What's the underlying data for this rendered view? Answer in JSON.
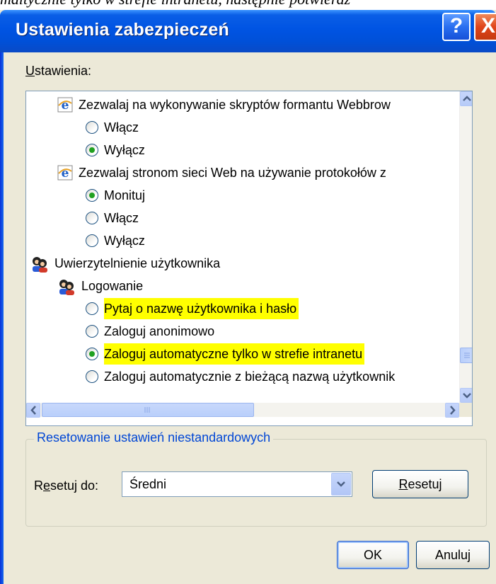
{
  "background_text": "maltycznie tylko w strefie intranetu, następnie potwierdź",
  "window": {
    "title": "Ustawienia zabezpieczeń",
    "help_label": "?",
    "close_label": "X"
  },
  "settings": {
    "label_first": "U",
    "label_rest": "stawienia:",
    "rows": [
      {
        "kind": "item",
        "icon": "ie-icon",
        "text": "Zezwalaj na wykonywanie skryptów formantu Webbrow"
      },
      {
        "kind": "radio",
        "text": "Włącz",
        "checked": false
      },
      {
        "kind": "radio",
        "text": "Wyłącz",
        "checked": true
      },
      {
        "kind": "item",
        "icon": "ie-icon",
        "text": "Zezwalaj stronom sieci Web na używanie protokołów z"
      },
      {
        "kind": "radio",
        "text": "Monituj",
        "checked": true
      },
      {
        "kind": "radio",
        "text": "Włącz",
        "checked": false
      },
      {
        "kind": "radio",
        "text": "Wyłącz",
        "checked": false
      },
      {
        "kind": "item",
        "icon": "user-icon",
        "text": "Uwierzytelnienie użytkownika"
      },
      {
        "kind": "item",
        "icon": "user-icon",
        "text": "Logowanie"
      },
      {
        "kind": "radio",
        "text": "Pytaj o nazwę użytkownika i hasło",
        "checked": false,
        "highlight": true
      },
      {
        "kind": "radio",
        "text": "Zaloguj anonimowo",
        "checked": false
      },
      {
        "kind": "radio",
        "text": "Zaloguj automatyczne tylko w strefie intranetu",
        "checked": true,
        "highlight": true
      },
      {
        "kind": "radio",
        "text": "Zaloguj automatycznie z bieżącą nazwą użytkownik",
        "checked": false
      }
    ]
  },
  "reset_group": {
    "title": "Resetowanie ustawień niestandardowych",
    "label_a": "R",
    "label_b": "e",
    "label_c": "setuj do:",
    "combo_value": "Średni",
    "reset_button_first": "R",
    "reset_button_rest": "esetuj"
  },
  "buttons": {
    "ok": "OK",
    "cancel": "Anuluj"
  },
  "colors": {
    "title_bar": "#0054e3",
    "highlight": "#ffff00",
    "group_title": "#0046d5"
  }
}
